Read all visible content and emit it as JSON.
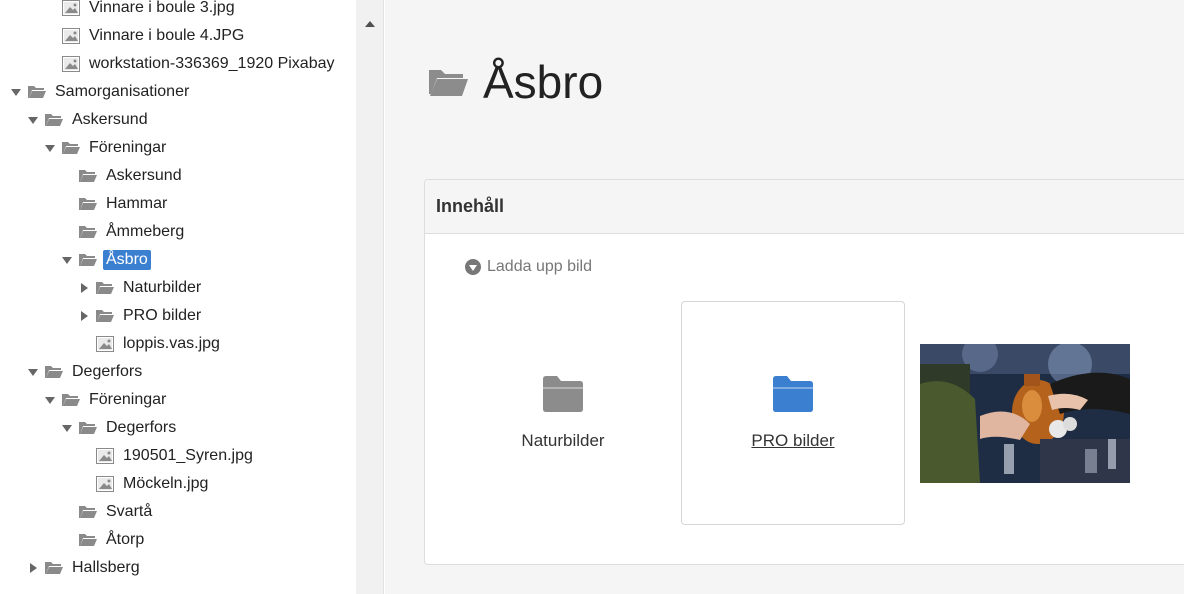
{
  "tree": {
    "items": [
      {
        "label": "Vinnare i boule 3.jpg",
        "type": "image",
        "toggle": "none",
        "depth": 2
      },
      {
        "label": "Vinnare i boule 4.JPG",
        "type": "image",
        "toggle": "none",
        "depth": 2
      },
      {
        "label": "workstation-336369_1920 Pixabay",
        "type": "image",
        "toggle": "none",
        "depth": 2
      },
      {
        "label": "Samorganisationer",
        "type": "folder",
        "toggle": "expanded",
        "depth": 0
      },
      {
        "label": "Askersund",
        "type": "folder",
        "toggle": "expanded",
        "depth": 1
      },
      {
        "label": "Föreningar",
        "type": "folder",
        "toggle": "expanded",
        "depth": 2
      },
      {
        "label": "Askersund",
        "type": "folder",
        "toggle": "none",
        "depth": 3
      },
      {
        "label": "Hammar",
        "type": "folder",
        "toggle": "none",
        "depth": 3
      },
      {
        "label": "Åmmeberg",
        "type": "folder",
        "toggle": "none",
        "depth": 3
      },
      {
        "label": "Åsbro",
        "type": "folder",
        "toggle": "expanded",
        "depth": 3,
        "selected": true
      },
      {
        "label": "Naturbilder",
        "type": "folder",
        "toggle": "collapsed",
        "depth": 4
      },
      {
        "label": "PRO bilder",
        "type": "folder",
        "toggle": "collapsed",
        "depth": 4
      },
      {
        "label": "loppis.vas.jpg",
        "type": "image",
        "toggle": "none",
        "depth": 4
      },
      {
        "label": "Degerfors",
        "type": "folder",
        "toggle": "expanded",
        "depth": 1
      },
      {
        "label": "Föreningar",
        "type": "folder",
        "toggle": "expanded",
        "depth": 2
      },
      {
        "label": "Degerfors",
        "type": "folder",
        "toggle": "expanded",
        "depth": 3
      },
      {
        "label": "190501_Syren.jpg",
        "type": "image",
        "toggle": "none",
        "depth": 4
      },
      {
        "label": "Möckeln.jpg",
        "type": "image",
        "toggle": "none",
        "depth": 4
      },
      {
        "label": "Svartå",
        "type": "folder",
        "toggle": "none",
        "depth": 3
      },
      {
        "label": "Åtorp",
        "type": "folder",
        "toggle": "none",
        "depth": 3
      },
      {
        "label": "Hallsberg",
        "type": "folder",
        "toggle": "collapsed",
        "depth": 1
      }
    ]
  },
  "main": {
    "title": "Åsbro",
    "panel": {
      "heading": "Innehåll",
      "upload_label": "Ladda upp bild",
      "tiles": [
        {
          "label": "Naturbilder",
          "icon": "folder-icon",
          "color": "#8c8c8c"
        },
        {
          "label": "PRO bilder",
          "icon": "folder-icon",
          "color": "#3b7fd0"
        }
      ]
    }
  },
  "colors": {
    "selection": "#3b7fd0",
    "folder_gray": "#8c8c8c",
    "folder_blue": "#3b7fd0",
    "background": "#f5f5f5"
  }
}
